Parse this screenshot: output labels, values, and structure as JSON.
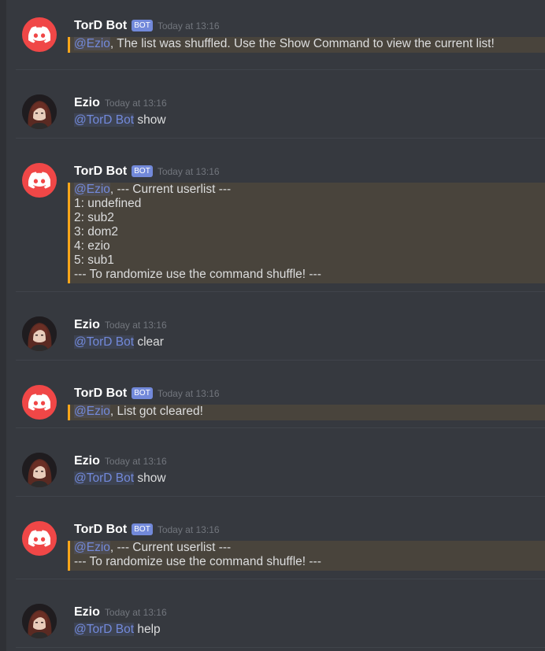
{
  "users": {
    "bot": {
      "name": "TorD Bot",
      "tag": "BOT"
    },
    "user": {
      "name": "Ezio"
    }
  },
  "timestamp": "Today at 13:16",
  "messages": [
    {
      "author": "TorD Bot",
      "bot": true,
      "time": "Today at 13:16",
      "mention": "@Ezio",
      "lines": [
        ", The list was shuffled. Use the Show Command to view the current list!"
      ]
    },
    {
      "author": "Ezio",
      "bot": false,
      "time": "Today at 13:16",
      "mention": "@TorD Bot",
      "lines": [
        " show"
      ]
    },
    {
      "author": "TorD Bot",
      "bot": true,
      "time": "Today at 13:16",
      "mention": "@Ezio",
      "lines": [
        ", --- Current userlist ---",
        "1: undefined",
        "2: sub2",
        "3: dom2",
        "4: ezio",
        "5: sub1",
        "--- To randomize use the command shuffle! ---"
      ]
    },
    {
      "author": "Ezio",
      "bot": false,
      "time": "Today at 13:16",
      "mention": "@TorD Bot",
      "lines": [
        " clear"
      ]
    },
    {
      "author": "TorD Bot",
      "bot": true,
      "time": "Today at 13:16",
      "mention": "@Ezio",
      "lines": [
        ", List got cleared!"
      ]
    },
    {
      "author": "Ezio",
      "bot": false,
      "time": "Today at 13:16",
      "mention": "@TorD Bot",
      "lines": [
        " show"
      ]
    },
    {
      "author": "TorD Bot",
      "bot": true,
      "time": "Today at 13:16",
      "mention": "@Ezio",
      "lines": [
        ", --- Current userlist ---",
        "--- To randomize use the command shuffle! ---"
      ]
    },
    {
      "author": "Ezio",
      "bot": false,
      "time": "Today at 13:16",
      "mention": "@TorD Bot",
      "lines": [
        " help"
      ]
    }
  ],
  "colors": {
    "background": "#36393f",
    "mention": "#7289da",
    "highlight": "#49443c",
    "highlight_border": "#faa61a",
    "bot_avatar": "#f04747"
  },
  "icons": {
    "bot_avatar": "discord-logo-icon",
    "user_avatar": "user-avatar-icon"
  }
}
